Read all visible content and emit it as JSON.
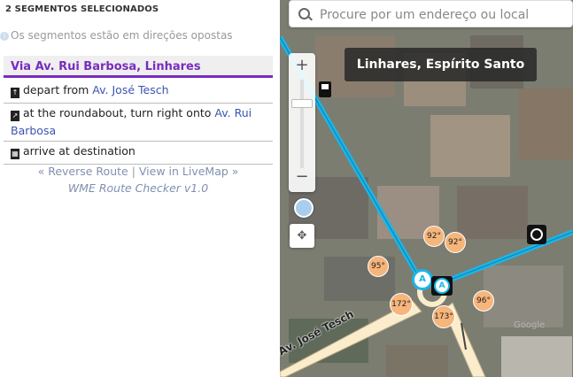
{
  "sidebar": {
    "header": "2 SEGMENTOS SELECIONADOS",
    "info": "Os segmentos estão em direções opostas",
    "route_title": "Via Av. Rui Barbosa, Linhares",
    "steps": [
      {
        "icon": "straight-arrow-icon",
        "text": "depart from ",
        "link": "Av. José Tesch"
      },
      {
        "icon": "turn-right-icon",
        "text": "at the roundabout, turn right onto ",
        "link": "Av. Rui Barbosa"
      },
      {
        "icon": "checkered-flag-icon",
        "text": "arrive at destination",
        "link": ""
      }
    ],
    "reverse_link": "« Reverse Route",
    "separator": "|",
    "livemap_link": "View in LiveMap »",
    "footer": "WME Route Checker v1.0"
  },
  "map": {
    "search_placeholder": "Procure por um endereço ou local",
    "location": "Linhares, Espírito Santo",
    "zoom_in": "+",
    "zoom_out": "−",
    "street_label": "Av. José Tesch",
    "node_label": "A",
    "angles": [
      "92°",
      "92°",
      "95°",
      "172°",
      "173°",
      "96°"
    ],
    "watermark": "Google",
    "colors": {
      "route": "#1cb5e8",
      "street": "#fbeccb",
      "angle_badge": "#f6b57a",
      "accent": "#7a2bbf"
    }
  }
}
